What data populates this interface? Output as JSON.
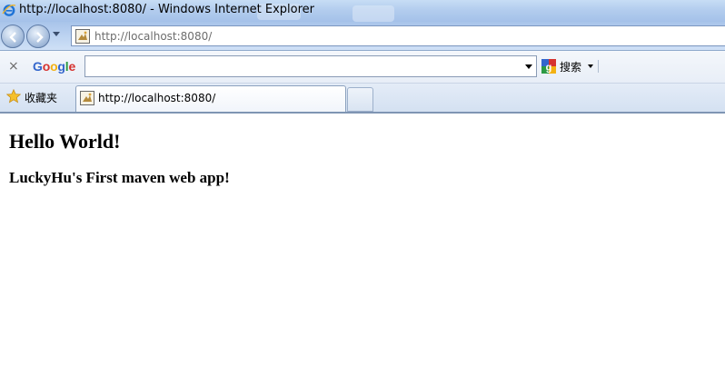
{
  "window": {
    "title": "http://localhost:8080/ - Windows Internet Explorer"
  },
  "address_bar": {
    "url": "http://localhost:8080/"
  },
  "google_toolbar": {
    "close_label": "×",
    "logo_text": "Google",
    "search_value": "",
    "search_button_label": "搜索"
  },
  "favorites_bar": {
    "favorites_label": "收藏夹"
  },
  "tabs": [
    {
      "label": "http://localhost:8080/",
      "active": true
    }
  ],
  "page": {
    "heading": "Hello World!",
    "subheading": "LuckyHu's First maven web app!"
  },
  "colors": {
    "google_blue": "#3366cc",
    "google_red": "#d6322f",
    "google_yellow": "#f3b112",
    "google_green": "#2c9a44"
  }
}
